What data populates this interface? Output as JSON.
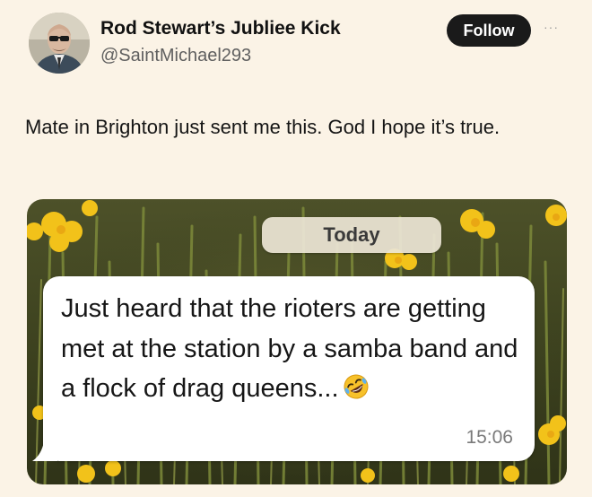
{
  "tweet": {
    "author_name": "Rod Stewart’s Jubliee Kick",
    "author_handle": "@SaintMichael293",
    "follow_label": "Follow",
    "more_label": "···",
    "text": "Mate in Brighton just sent me this. God I hope it’s true."
  },
  "chat": {
    "date_label": "Today",
    "message_text": "Just heard that the rioters are getting met at the station by a samba band and a flock of drag queens...",
    "emoji": "rolling-on-floor-laughing",
    "time": "15:06"
  },
  "colors": {
    "page_background": "#fbf3e6",
    "follow_button": "#1a1a1a",
    "bubble": "#ffffff",
    "daffodil": "#f2c21a"
  }
}
